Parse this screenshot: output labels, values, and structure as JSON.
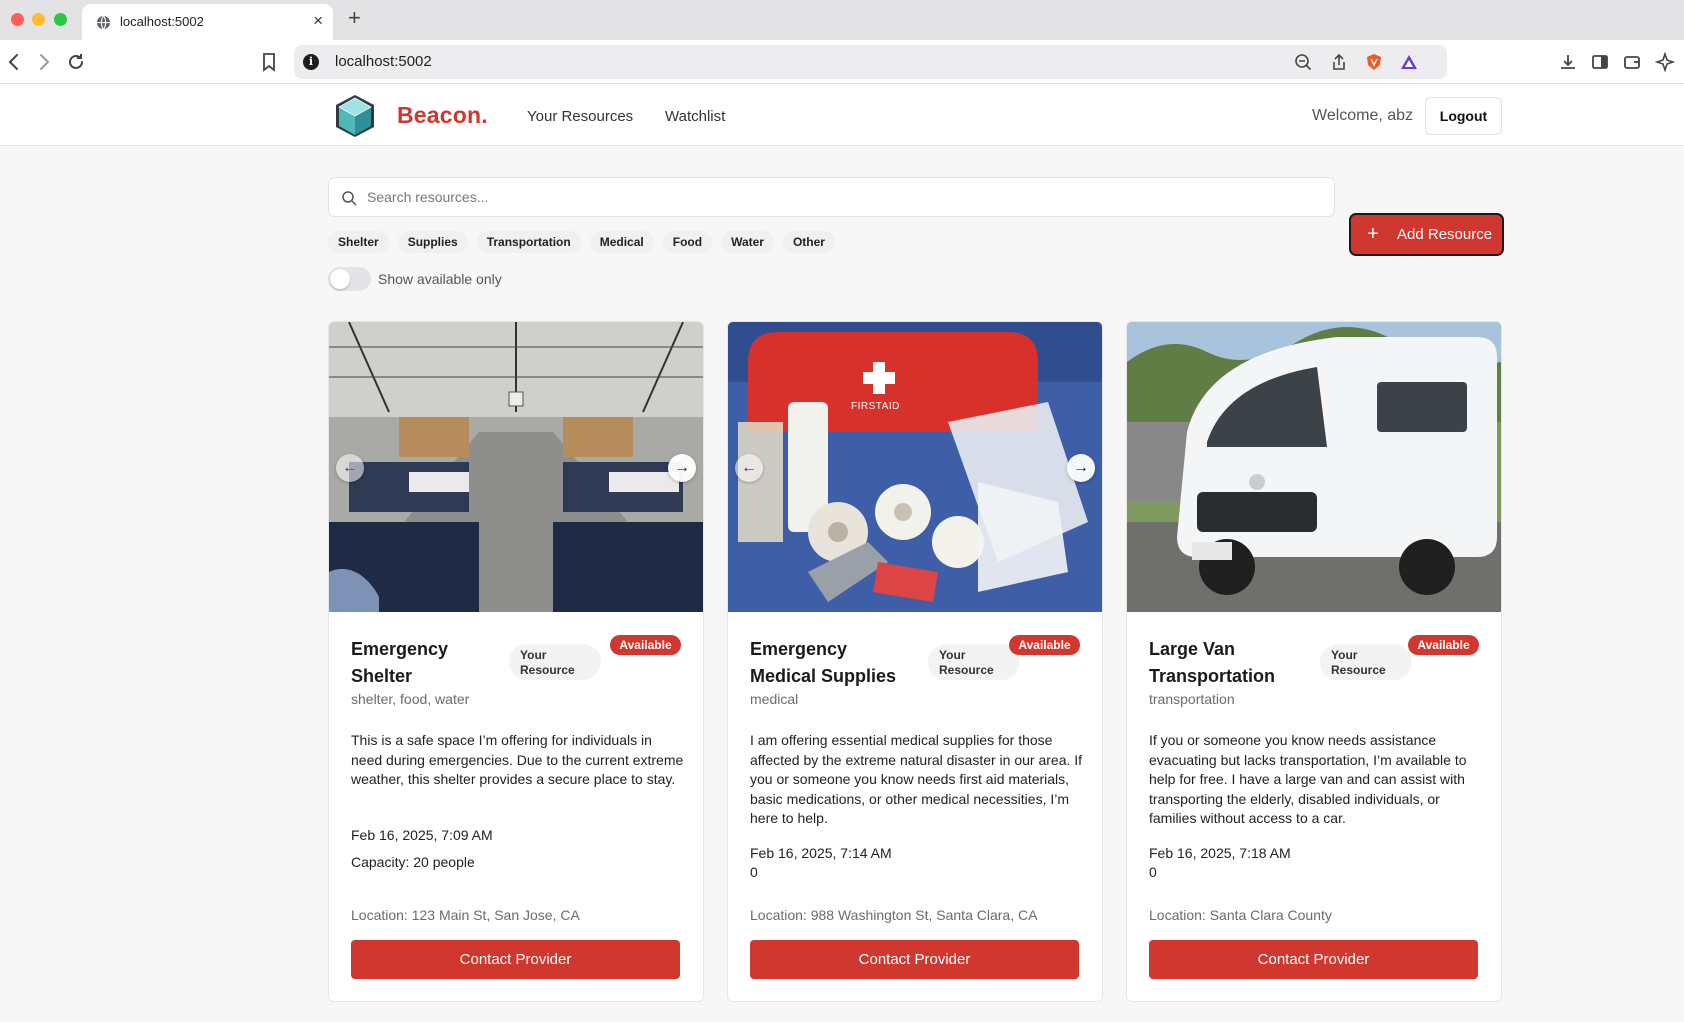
{
  "browser": {
    "tab_title": "localhost:5002",
    "url": "localhost:5002"
  },
  "header": {
    "brand": "Beacon.",
    "nav": [
      "Your Resources",
      "Watchlist"
    ],
    "welcome": "Welcome, abz",
    "logout_label": "Logout"
  },
  "filters": {
    "search_placeholder": "Search resources...",
    "add_label": "Add Resource",
    "categories": [
      "Shelter",
      "Supplies",
      "Transportation",
      "Medical",
      "Food",
      "Water",
      "Other"
    ],
    "toggle_label": "Show available only",
    "toggle_on": false
  },
  "colors": {
    "accent": "#d0382f",
    "text": "#1a1a1a",
    "muted": "#6b6b6b"
  },
  "cards": [
    {
      "title": "Emergency Shelter",
      "owner_badge": "Your Resource",
      "status": "Available",
      "categories": "shelter, food, water",
      "description": "This is a safe space I’m offering for individuals in need during emergencies. Due to the current extreme weather, this shelter provides a secure place to stay.",
      "date": "Feb 16, 2025, 7:09 AM",
      "extra": "Capacity: 20 people",
      "location": "Location: 123 Main St, San Jose, CA",
      "contact_label": "Contact Provider"
    },
    {
      "title": "Emergency Medical Supplies",
      "owner_badge": "Your Resource",
      "status": "Available",
      "categories": "medical",
      "description": "I am offering essential medical supplies for those affected by the extreme natural disaster in our area. If you or someone you know needs first aid materials, basic medications, or other medical necessities, I’m here to help.",
      "date": "Feb 16, 2025, 7:14 AM",
      "extra": "0",
      "location": "Location: 988 Washington St, Santa Clara, CA",
      "contact_label": "Contact Provider",
      "image_text": "FIRSTAID"
    },
    {
      "title": "Large Van Transportation",
      "owner_badge": "Your Resource",
      "status": "Available",
      "categories": "transportation",
      "description": "If you or someone you know needs assistance evacuating but lacks transportation, I’m available to help for free. I have a large van and can assist with transporting the elderly, disabled individuals, or families without access to a car.",
      "date": "Feb 16, 2025, 7:18 AM",
      "extra": "0",
      "location": "Location: Santa Clara County",
      "contact_label": "Contact Provider"
    }
  ]
}
